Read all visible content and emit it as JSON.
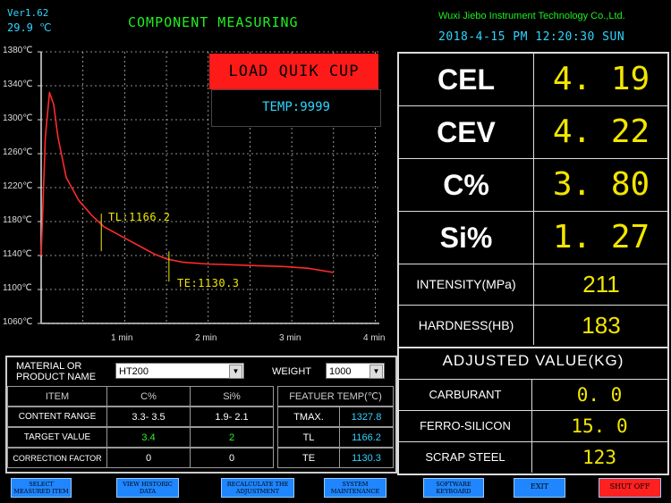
{
  "header": {
    "version": "Ver1.62",
    "ambient_temp": "29.9 ℃",
    "title": "COMPONENT MEASURING",
    "company": "Wuxi Jiebo Instrument Technology Co.,Ltd.",
    "datetime": "2018-4-15 PM 12:20:30  SUN"
  },
  "chart": {
    "load_status": "LOAD QUIK CUP",
    "temp_readout": "TEMP:9999",
    "y_ticks": [
      "1380℃",
      "1340℃",
      "1300℃",
      "1260℃",
      "1220℃",
      "1180℃",
      "1140℃",
      "1100℃",
      "1060℃"
    ],
    "x_ticks": [
      "1 min",
      "2 min",
      "3 min",
      "4 min"
    ],
    "tl_label": "TL:1166.2",
    "te_label": "TE:1130.3",
    "curve_color": "#ff2a2a"
  },
  "chart_data": {
    "type": "line",
    "ylim": [
      1060,
      1380
    ],
    "xlim": [
      0,
      4
    ],
    "x_ticks_min": [
      1,
      2,
      3,
      4
    ],
    "series": [
      {
        "x": [
          0.0,
          0.05,
          0.1,
          0.15,
          0.2,
          0.3,
          0.45,
          0.6,
          0.75,
          0.9,
          1.05,
          1.2,
          1.35,
          1.5,
          1.7,
          2.0,
          2.3,
          2.6,
          2.9,
          3.2,
          3.5
        ],
        "y": [
          1140,
          1280,
          1332,
          1318,
          1280,
          1232,
          1205,
          1188,
          1174,
          1166,
          1158,
          1150,
          1142,
          1136,
          1132,
          1130,
          1129,
          1128,
          1127,
          1125,
          1120
        ]
      }
    ],
    "tl": {
      "x": 0.72,
      "y": 1166.2
    },
    "te": {
      "x": 1.53,
      "y": 1130.3
    },
    "grid": true
  },
  "readings": [
    {
      "label": "CEL",
      "value": "4. 19"
    },
    {
      "label": "CEV",
      "value": "4. 22"
    },
    {
      "label": "C%",
      "value": "3. 80"
    },
    {
      "label": "Si%",
      "value": "1. 27"
    },
    {
      "label": "INTENSITY(MPa)",
      "value": "211"
    },
    {
      "label": "HARDNESS(HB)",
      "value": "183"
    }
  ],
  "adjusted": {
    "title": "ADJUSTED VALUE(KG)",
    "rows": [
      {
        "label": "CARBURANT",
        "value": "0. 0"
      },
      {
        "label": "FERRO-SILICON",
        "value": "15. 0"
      },
      {
        "label": "SCRAP STEEL",
        "value": "123"
      }
    ]
  },
  "material": {
    "label_line1": "MATERIAL OR",
    "label_line2": "PRODUCT NAME",
    "value": "HT200",
    "weight_label": "WEIGHT",
    "weight_value": "1000",
    "headers": [
      "ITEM",
      "C%",
      "Si%"
    ],
    "rows": [
      {
        "item": "CONTENT RANGE",
        "c": "3.3- 3.5",
        "si": "1.9- 2.1"
      },
      {
        "item": "TARGET VALUE",
        "c": "3.4",
        "si": "2"
      },
      {
        "item": "CORRECTION FACTOR",
        "c": "0",
        "si": "0"
      }
    ],
    "feature_header": "FEATUER TEMP(℃)",
    "features": [
      {
        "label": "TMAX.",
        "value": "1327.8"
      },
      {
        "label": "TL",
        "value": "1166.2"
      },
      {
        "label": "TE",
        "value": "1130.3"
      }
    ]
  },
  "buttons": [
    {
      "line1": "SELECT",
      "line2": "MEASURED ITEM"
    },
    {
      "line1": "VIEW HISTORIC",
      "line2": "DATA"
    },
    {
      "line1": "RECALCULATE THE",
      "line2": "ADJUSTMENT"
    },
    {
      "line1": "SYSTEM",
      "line2": "MAINTENANCE"
    },
    {
      "line1": "SOFTWARE",
      "line2": "KEYBOARD"
    },
    {
      "line1": "EXIT",
      "line2": ""
    },
    {
      "line1": "SHUT OFF",
      "line2": ""
    }
  ]
}
